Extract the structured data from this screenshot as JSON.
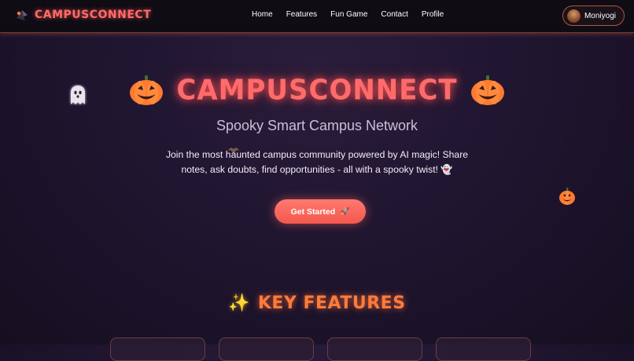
{
  "brand": {
    "name": "CAMPUSCONNECT"
  },
  "nav": {
    "links": [
      "Home",
      "Features",
      "Fun Game",
      "Contact",
      "Profile"
    ]
  },
  "user": {
    "name": "Moniyogi"
  },
  "hero": {
    "title": "CAMPUSCONNECT",
    "subtitle": "Spooky Smart Campus Network",
    "description": "Join the most haunted campus community powered by AI magic! Share notes, ask doubts, find opportunities - all with a spooky twist! 👻",
    "cta_label": "Get Started",
    "cta_icon": "rocket-icon"
  },
  "features": {
    "title": "KEY FEATURES",
    "icon": "sparkles-icon"
  },
  "colors": {
    "accent": "#ff6b6b",
    "cta": "#f4574d",
    "features_title": "#ff7b3a",
    "background": "#221733",
    "navbar": "#0f0c14"
  }
}
